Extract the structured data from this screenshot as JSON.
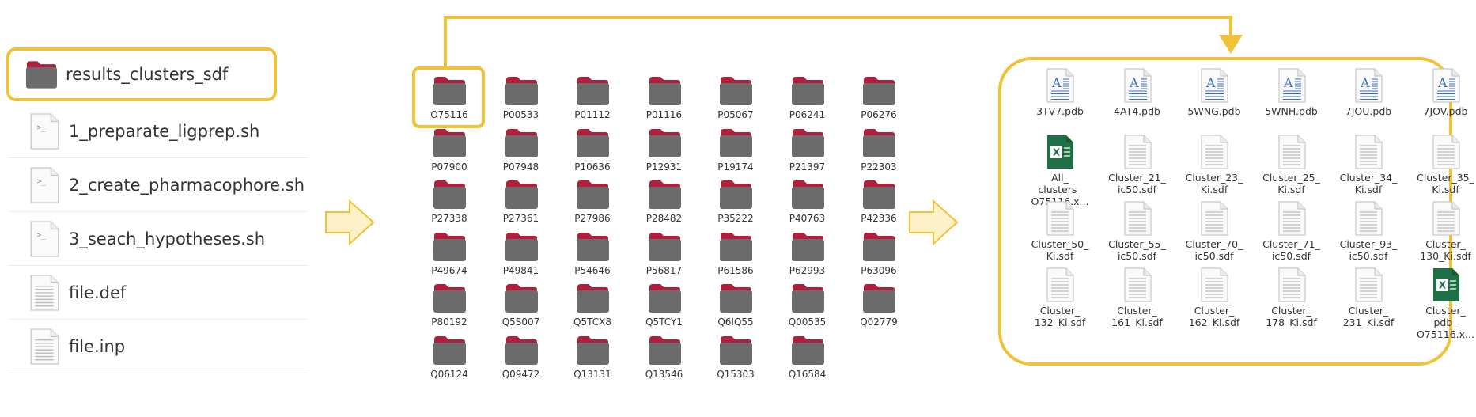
{
  "left_list": [
    {
      "label": "results_clusters_sdf",
      "icon": "folder-icon",
      "selected": true
    },
    {
      "label": "1_preparate_ligprep.sh",
      "icon": "script-icon"
    },
    {
      "label": "2_create_pharmacophore.sh",
      "icon": "script-icon"
    },
    {
      "label": "3_seach_hypotheses.sh",
      "icon": "script-icon"
    },
    {
      "label": "file.def",
      "icon": "text-file-icon"
    },
    {
      "label": "file.inp",
      "icon": "text-file-icon"
    }
  ],
  "folders": [
    "O75116",
    "P00533",
    "P01112",
    "P01116",
    "P05067",
    "P06241",
    "P06276",
    "P07900",
    "P07948",
    "P10636",
    "P12931",
    "P19174",
    "P21397",
    "P22303",
    "P27338",
    "P27361",
    "P27986",
    "P28482",
    "P35222",
    "P40763",
    "P42336",
    "P49674",
    "P49841",
    "P54646",
    "P56817",
    "P61586",
    "P62993",
    "P63096",
    "P80192",
    "Q5S007",
    "Q5TCX8",
    "Q5TCY1",
    "Q6IQ55",
    "Q00535",
    "Q02779",
    "Q06124",
    "Q09472",
    "Q13131",
    "Q13546",
    "Q15303",
    "Q16584"
  ],
  "selected_folder": "O75116",
  "files": [
    {
      "name": "3TV7.pdb",
      "icon": "pdb-icon"
    },
    {
      "name": "4AT4.pdb",
      "icon": "pdb-icon"
    },
    {
      "name": "5WNG.pdb",
      "icon": "pdb-icon"
    },
    {
      "name": "5WNH.pdb",
      "icon": "pdb-icon"
    },
    {
      "name": "7JOU.pdb",
      "icon": "pdb-icon"
    },
    {
      "name": "7JOV.pdb",
      "icon": "pdb-icon"
    },
    {
      "name": "All_\nclusters_\nO75116.x...",
      "icon": "spreadsheet-icon"
    },
    {
      "name": "Cluster_21_\nic50.sdf",
      "icon": "text-file-icon"
    },
    {
      "name": "Cluster_23_\nKi.sdf",
      "icon": "text-file-icon"
    },
    {
      "name": "Cluster_25_\nKi.sdf",
      "icon": "text-file-icon"
    },
    {
      "name": "Cluster_34_\nKi.sdf",
      "icon": "text-file-icon"
    },
    {
      "name": "Cluster_35_\nKi.sdf",
      "icon": "text-file-icon"
    },
    {
      "name": "Cluster_50_\nKi.sdf",
      "icon": "text-file-icon"
    },
    {
      "name": "Cluster_55_\nic50.sdf",
      "icon": "text-file-icon"
    },
    {
      "name": "Cluster_70_\nic50.sdf",
      "icon": "text-file-icon"
    },
    {
      "name": "Cluster_71_\nic50.sdf",
      "icon": "text-file-icon"
    },
    {
      "name": "Cluster_93_\nic50.sdf",
      "icon": "text-file-icon"
    },
    {
      "name": "Cluster_\n130_Ki.sdf",
      "icon": "text-file-icon"
    },
    {
      "name": "Cluster_\n132_Ki.sdf",
      "icon": "text-file-icon"
    },
    {
      "name": "Cluster_\n161_Ki.sdf",
      "icon": "text-file-icon"
    },
    {
      "name": "Cluster_\n162_Ki.sdf",
      "icon": "text-file-icon"
    },
    {
      "name": "Cluster_\n178_Ki.sdf",
      "icon": "text-file-icon"
    },
    {
      "name": "Cluster_\n231_Ki.sdf",
      "icon": "text-file-icon"
    },
    {
      "name": "Cluster_\npdb_\nO75116.x...",
      "icon": "spreadsheet-icon"
    }
  ],
  "colors": {
    "highlight": "#f0c237",
    "arrow_fill": "#fdf1c8",
    "arrow_stroke": "#f0c237",
    "folder_body": "#6b6b6b",
    "folder_tab": "#b21f3c",
    "spreadsheet": "#1e7145",
    "pdb_blue": "#3b6fc4"
  }
}
